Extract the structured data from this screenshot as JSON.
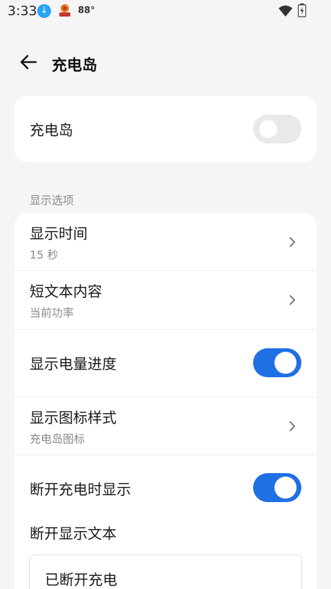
{
  "status_bar": {
    "time": "3:33",
    "temperature": "88°",
    "icons": [
      "download-icon",
      "app-notification-icon",
      "wifi-icon",
      "battery-charging-icon"
    ]
  },
  "header": {
    "title": "充电岛",
    "back_icon": "arrow-left-icon"
  },
  "main_toggle": {
    "label": "充电岛",
    "enabled": false
  },
  "section_label": "显示选项",
  "options": [
    {
      "title": "显示时间",
      "subtitle": "15 秒",
      "control": "chevron"
    },
    {
      "title": "短文本内容",
      "subtitle": "当前功率",
      "control": "chevron"
    },
    {
      "title": "显示电量进度",
      "control": "toggle",
      "enabled": true
    },
    {
      "title": "显示图标样式",
      "subtitle": "充电岛图标",
      "control": "chevron"
    },
    {
      "title": "断开充电时显示",
      "control": "toggle",
      "enabled": true
    }
  ],
  "disconnect_text": {
    "label": "断开显示文本",
    "value": "已断开充电"
  },
  "colors": {
    "accent": "#1f6fe5",
    "background": "#f5f5f6",
    "card": "#ffffff",
    "toggle_off": "#e9e9ec"
  }
}
